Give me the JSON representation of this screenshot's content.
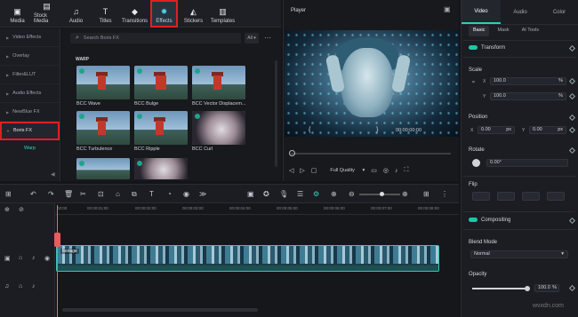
{
  "toolbar": {
    "items": [
      {
        "label": "Media",
        "icon": "media-icon"
      },
      {
        "label": "Stock Media",
        "icon": "stock-media-icon"
      },
      {
        "label": "Audio",
        "icon": "audio-icon"
      },
      {
        "label": "Titles",
        "icon": "titles-icon"
      },
      {
        "label": "Transitions",
        "icon": "transitions-icon"
      },
      {
        "label": "Effects",
        "icon": "effects-icon"
      },
      {
        "label": "Stickers",
        "icon": "stickers-icon"
      },
      {
        "label": "Templates",
        "icon": "templates-icon"
      }
    ],
    "active": "Effects"
  },
  "categories": {
    "items": [
      "Video Effects",
      "Overlay",
      "Filter&LUT",
      "Audio Effects",
      "NewBlue FX",
      "Boris FX"
    ],
    "selected": "Boris FX",
    "sub_item": "Warp"
  },
  "browser": {
    "search_placeholder": "Search Boris FX",
    "filter": "All",
    "section": "WARP",
    "effects": [
      "BCC Wave",
      "BCC Bulge",
      "BCC Vector Displacem...",
      "BCC Turbulence",
      "BCC Ripple",
      "BCC Curl"
    ]
  },
  "player": {
    "title": "Player",
    "timecode": "00:00:00:00",
    "quality": "Full Quality"
  },
  "props": {
    "tabs": [
      "Video",
      "Audio",
      "Color"
    ],
    "active_tab": "Video",
    "subtabs": [
      "Basic",
      "Mask",
      "AI Tools"
    ],
    "active_subtab": "Basic",
    "transform": "Transform",
    "scale_label": "Scale",
    "scale_x_axis": "X",
    "scale_y_axis": "Y",
    "scale_x": "100.0",
    "scale_y": "100.0",
    "pct": "%",
    "position_label": "Position",
    "pos_x_axis": "X",
    "pos_y_axis": "Y",
    "pos_x": "0.00",
    "pos_y": "0.00",
    "px": "px",
    "rotate_label": "Rotate",
    "rotate": "0.00°",
    "flip_label": "Flip",
    "compositing": "Compositing",
    "blend_label": "Blend Mode",
    "blend_value": "Normal",
    "opacity_label": "Opacity",
    "opacity": "100.0",
    "opacity_level": 1.0
  },
  "timeline": {
    "ruler": [
      "00:00",
      "00:00:01:00",
      "00:00:02:00",
      "00:00:03:00",
      "00:00:04:00",
      "00:00:05:00",
      "00:00:06:00",
      "00:00:07:00",
      "00:00:08:00",
      "00:00:09:00"
    ],
    "clip_name": "footage"
  },
  "watermark": "wvxdn.com",
  "colors": {
    "accent": "#2ad0b8",
    "highlight": "#e02020"
  }
}
